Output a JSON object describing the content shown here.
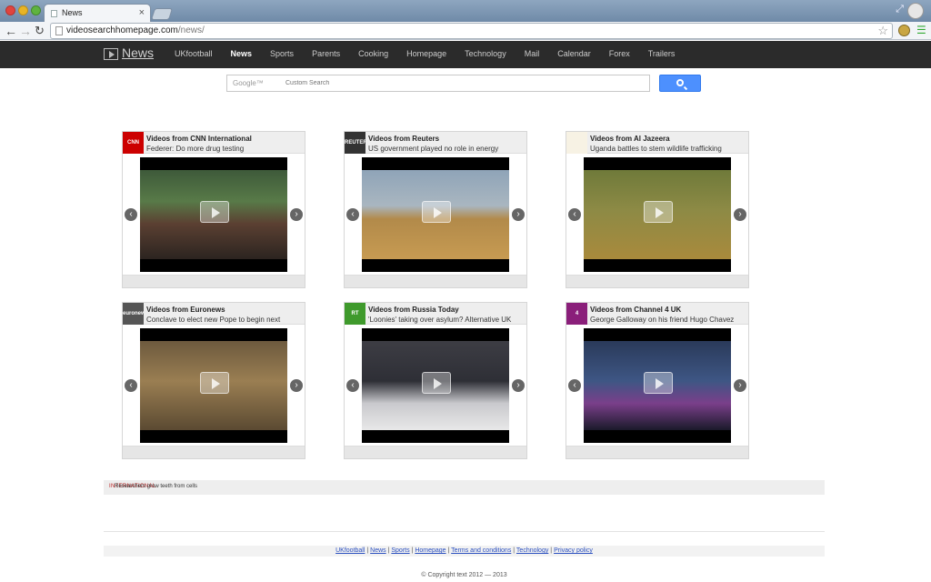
{
  "browser": {
    "tab_title": "News",
    "url_host": "videosearchhomepage.com",
    "url_path": "/news/"
  },
  "site": {
    "brand": "News",
    "nav": [
      "UKfootball",
      "News",
      "Sports",
      "Parents",
      "Cooking",
      "Homepage",
      "Technology",
      "Mail",
      "Calendar",
      "Forex",
      "Trailers"
    ],
    "active_nav": "News"
  },
  "search": {
    "brand": "Google™",
    "placeholder": "Custom Search"
  },
  "cards": [
    {
      "source": "Videos from CNN International",
      "headline": "Federer: Do more drug testing",
      "logo": "CNN",
      "logo_color": "#cc0000"
    },
    {
      "source": "Videos from Reuters",
      "headline": "US government played no role in energy",
      "logo": "REUTERS",
      "logo_color": "#333333"
    },
    {
      "source": "Videos from Al Jazeera",
      "headline": "Uganda battles to stem wildlife trafficking",
      "logo": "",
      "logo_color": "#f7f2e4"
    },
    {
      "source": "Videos from Euronews",
      "headline": "Conclave to elect new Pope to begin next",
      "logo": "euronews",
      "logo_color": "#555555"
    },
    {
      "source": "Videos from Russia Today",
      "headline": "'Loonies' taking over asylum? Alternative UK",
      "logo": "RT",
      "logo_color": "#3f9a2c"
    },
    {
      "source": "Videos from Channel 4 UK",
      "headline": "George Galloway on his friend Hugo Chavez",
      "logo": "4",
      "logo_color": "#8a1f7a"
    }
  ],
  "ticker": {
    "tag": "INTERNATIONAL",
    "text": "Researchers grow teeth from cells"
  },
  "footer": {
    "links": [
      "UKfootball",
      "News",
      "Sports",
      "Homepage",
      "Terms and conditions",
      "Technology",
      "Privacy policy"
    ],
    "copyright": "© Copyright text 2012 — 2013"
  },
  "colors": {
    "nav_bg": "#2b2b2b",
    "search_button": "#4d90fe",
    "link": "#2a4fbf"
  }
}
